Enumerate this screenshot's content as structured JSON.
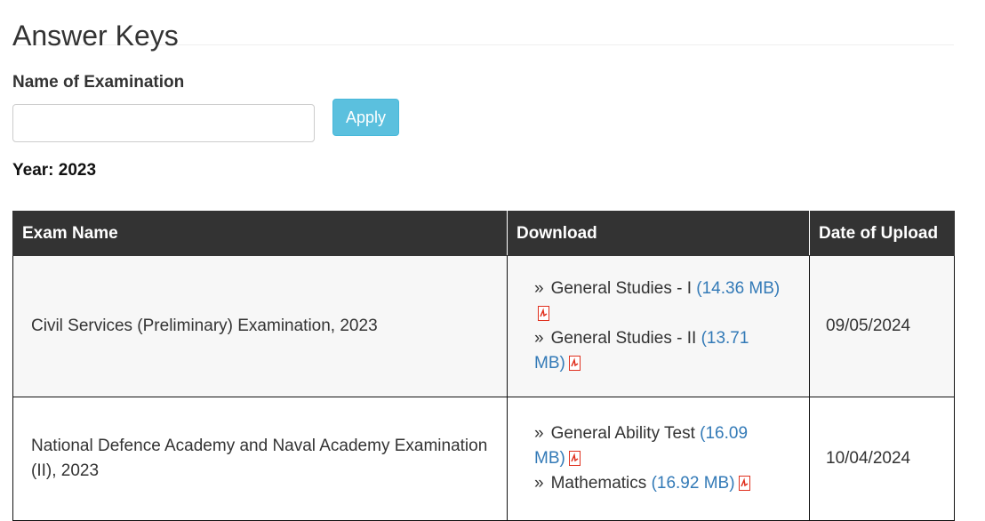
{
  "page": {
    "title": "Answer Keys",
    "filter_label": "Name of Examination",
    "search_value": "",
    "apply_label": "Apply",
    "year_label": "Year: 2023"
  },
  "table": {
    "headers": [
      "Exam Name",
      "Download",
      "Date of Upload"
    ],
    "rows": [
      {
        "exam": "Civil Services (Preliminary) Examination, 2023",
        "links": [
          {
            "bullet": "»",
            "name": "General Studies - I",
            "size": "(14.36 MB)",
            "icon": "pdf-icon"
          },
          {
            "bullet": "»",
            "name": "General Studies - II",
            "size": "(13.71 MB)",
            "icon": "pdf-icon"
          }
        ],
        "date": "09/05/2024"
      },
      {
        "exam": "National Defence Academy and Naval Academy Examination (II), 2023",
        "links": [
          {
            "bullet": "»",
            "name": "General Ability Test",
            "size": "(16.09 MB)",
            "icon": "pdf-icon"
          },
          {
            "bullet": "»",
            "name": "Mathematics",
            "size": "(16.92 MB)",
            "icon": "pdf-icon"
          }
        ],
        "date": "10/04/2024"
      }
    ]
  },
  "colors": {
    "header_bg": "#333333",
    "apply_bg": "#5bc0de",
    "link": "#337ab7",
    "pdf_icon": "#e0301e"
  }
}
